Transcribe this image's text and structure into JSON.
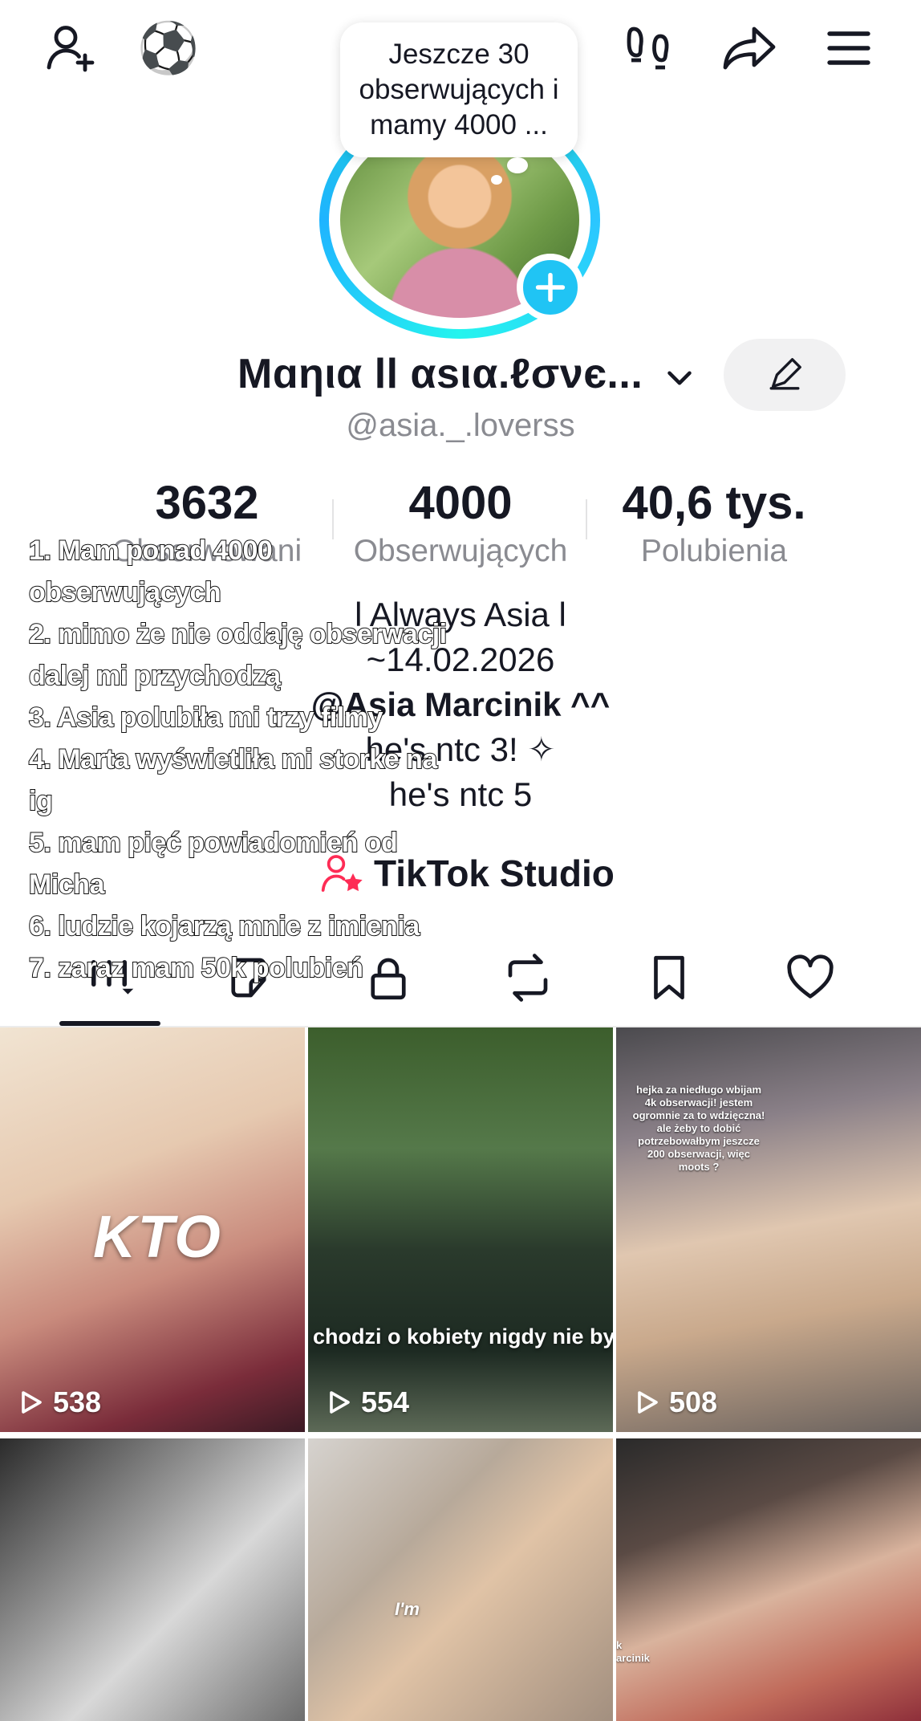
{
  "top_bar": {
    "icons": [
      "add-user-icon",
      "soccer-ball-icon",
      "footprints-icon",
      "share-icon",
      "menu-icon"
    ],
    "soccer_glyph": "⚽"
  },
  "note_bubble": {
    "text": "Jeszcze 30 obserwujących i mamy 4000 ..."
  },
  "profile": {
    "display_name": "Mɑηια ll αsια.ℓσνє...",
    "username": "@asia._.loverss"
  },
  "stats": [
    {
      "value": "3632",
      "label": "Obserwowani"
    },
    {
      "value": "4000",
      "label": "Obserwujących"
    },
    {
      "value": "40,6 tys.",
      "label": "Polubienia"
    }
  ],
  "bio": {
    "lines": [
      "l Always Asia l",
      "~14.02.2026",
      "@Asia Marcinik ^^",
      "he's ntc 3! ✧",
      "he's ntc 5"
    ]
  },
  "studio_link": {
    "label": "TikTok Studio"
  },
  "overlay_list": [
    "1. Mam ponad 4000",
    "obserwujących",
    "2. mimo że nie oddaję obserwacji",
    "dalej mi przychodzą",
    "3. Asia polubiła mi trzy filmy",
    "4. Marta wyświetliła mi storke na",
    "ig",
    "5. mam pięć powiadomień od",
    "Micha",
    "6. ludzie kojarzą mnie z imienia",
    "7. zaraz mam 50k polubień"
  ],
  "tabs": [
    "videos-tab",
    "reposts-tab",
    "private-tab",
    "repost-tab",
    "saved-tab",
    "liked-tab"
  ],
  "videos": [
    {
      "views": "538",
      "caption": "KTO"
    },
    {
      "views": "554",
      "caption": "chodzi o kobiety nigdy nie byłem odwa"
    },
    {
      "views": "508",
      "caption": "hejka za niedługo wbijam 4k obserwacji! jestem ogromnie za to wdzięczna! ale żeby to dobić potrzebowałbym jeszcze 200 obserwacji, więc moots ?"
    },
    {
      "views": "",
      "caption": ""
    },
    {
      "views": "",
      "caption": "I'm"
    },
    {
      "views": "",
      "caption": "k\narcinik"
    }
  ],
  "colors": {
    "accent_cyan": "#20c4f4",
    "text": "#161823",
    "muted": "#8a8b91"
  }
}
